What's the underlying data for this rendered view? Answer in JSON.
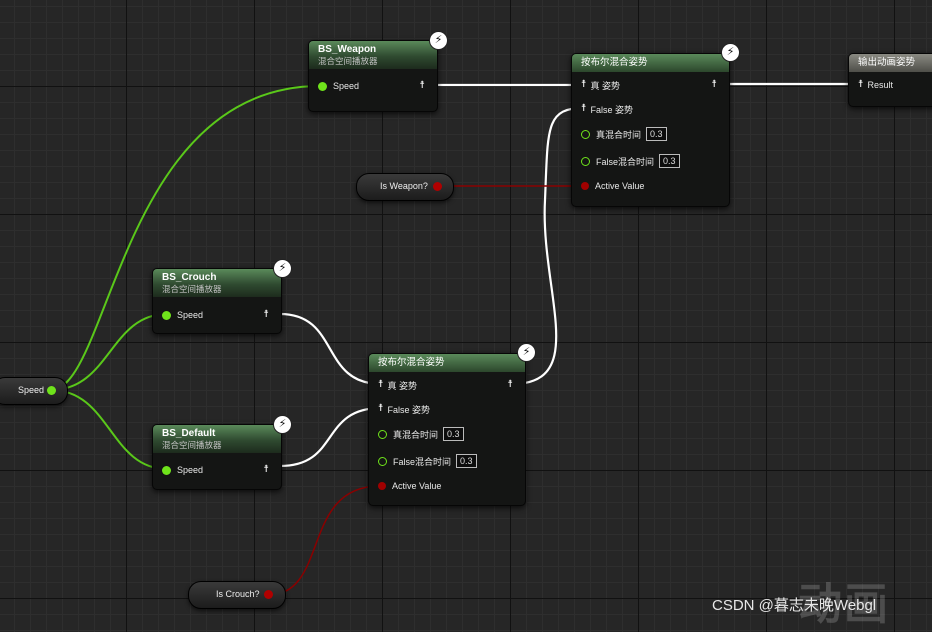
{
  "pose_glyph": "☨",
  "bolt_glyph": "⚡",
  "colors": {
    "float_pin": "#6fe31b",
    "bool_pin": "#a00000",
    "exec_wire": "#ffffff"
  },
  "nodes": {
    "bs_weapon": {
      "title": "BS_Weapon",
      "subtitle": "混合空间播放器",
      "input": "Speed"
    },
    "bs_crouch": {
      "title": "BS_Crouch",
      "subtitle": "混合空间播放器",
      "input": "Speed"
    },
    "bs_default": {
      "title": "BS_Default",
      "subtitle": "混合空间播放器",
      "input": "Speed"
    },
    "blend_top": {
      "title": "按布尔混合姿势",
      "true_pose": "真 姿势",
      "false_pose": "False 姿势",
      "true_time_label": "真混合时间",
      "true_time": "0.3",
      "false_time_label": "False混合时间",
      "false_time": "0.3",
      "active": "Active Value"
    },
    "blend_bottom": {
      "title": "按布尔混合姿势",
      "true_pose": "真 姿势",
      "false_pose": "False 姿势",
      "true_time_label": "真混合时间",
      "true_time": "0.3",
      "false_time_label": "False混合时间",
      "false_time": "0.3",
      "active": "Active Value"
    },
    "output": {
      "title": "输出动画姿势",
      "result": "Result"
    }
  },
  "variables": {
    "speed": "Speed",
    "is_weapon": "Is Weapon?",
    "is_crouch": "Is Crouch?"
  },
  "watermark": {
    "text": "CSDN @暮志未晚Webgl",
    "logo": "动画"
  }
}
